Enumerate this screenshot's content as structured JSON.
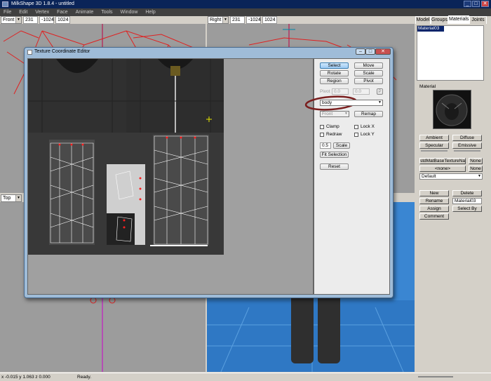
{
  "window": {
    "title": "MilkShape 3D 1.8.4 - untitled",
    "minimize": "_",
    "maximize": "□",
    "close": "✕"
  },
  "menu": [
    "File",
    "Edit",
    "Vertex",
    "Face",
    "Animate",
    "Tools",
    "Window",
    "Help"
  ],
  "viewports": {
    "front": {
      "view": "Front",
      "v1": "231",
      "v2": "-1024",
      "v3": "1024"
    },
    "right": {
      "view": "Right",
      "v1": "231",
      "v2": "-1024",
      "v3": "1024"
    },
    "top": {
      "view": "Top"
    }
  },
  "tabs": [
    "Model",
    "Groups",
    "Materials",
    "Joints"
  ],
  "active_tab": "Materials",
  "materials": {
    "list": [
      "Material03"
    ],
    "selected": "Material03",
    "section_label": "Material",
    "buttons": {
      "ambient": "Ambient",
      "diffuse": "Diffuse",
      "specular": "Specular",
      "emissive": "Emissive",
      "texture": "stdMatBaseTextureNam",
      "none1": "None",
      "none_dropdown": "<none>",
      "none2": "None",
      "mode": "Default",
      "new": "New",
      "delete": "Delete",
      "rename": "Rename",
      "assign": "Assign",
      "select_by": "Select By",
      "comment": "Comment"
    },
    "name_value": "Material03"
  },
  "dialog": {
    "title": "Texture Coordinate Editor",
    "tools": {
      "select": "Select",
      "move": "Move",
      "rotate": "Rotate",
      "scale": "Scale",
      "region": "Region",
      "pivot": "Pivot"
    },
    "pivot_label": "Pivot",
    "pivot_x": "0.0",
    "pivot_y": "0.0",
    "pivot_p": "P",
    "group_combo": "body",
    "mapping_combo": "Front",
    "remap": "Remap",
    "clamp": "Clamp",
    "lock_x": "Lock X",
    "redraw": "Redraw",
    "lock_y": "Lock Y",
    "scale_value": "0.5",
    "scale_button": "Scale",
    "fit_selection": "Fit Selection",
    "reset": "Reset"
  },
  "status": {
    "coords": "x -0.015 y 1.063 z 0.000",
    "message": "Ready."
  },
  "colors": {
    "title_bg": "#0a2458",
    "menu_bg": "#404040",
    "wire_red": "#e02020",
    "viewport_blue": "#2f78c4",
    "highlight_circle": "#7a1e1e"
  },
  "icons": {
    "app": "milkshape-icon",
    "dialog": "texture-editor-icon",
    "crosshair": "crosshair-icon"
  }
}
